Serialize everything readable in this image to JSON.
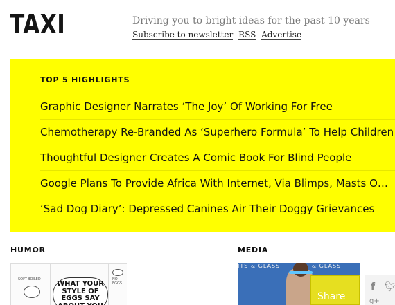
{
  "header": {
    "logo": "TAXI",
    "tagline": "Driving you to bright ideas for the past 10 years",
    "links": [
      "Subscribe to newsletter",
      "RSS",
      "Advertise"
    ]
  },
  "highlights": {
    "title": "TOP 5 HIGHLIGHTS",
    "items": [
      "Graphic Designer Narrates ‘The Joy’ Of Working For Free",
      "Chemotherapy Re-Branded As ‘Superhero Formula’ To Help Children",
      "Thoughtful Designer Creates A Comic Book For Blind People",
      "Google Plans To Provide Africa With Internet, Via Blimps, Masts O…",
      "‘Sad Dog Diary’: Depressed Canines Air Their Doggy Grievances"
    ],
    "background_color": "#ffff00"
  },
  "sections": {
    "humor": {
      "label": "HUMOR"
    },
    "media": {
      "label": "MEDIA"
    }
  },
  "humor_thumb": {
    "panel1": "SOFT-BOILED",
    "bubble": "WHAT YOUR STYLE OF EGGS SAY ABOUT YOU",
    "panel3": "NO EGGS"
  },
  "media_thumb": {
    "sign1": "ITS & GLASS",
    "sign2": "ITS & GLASS"
  },
  "share": {
    "label": "Share",
    "icons": [
      "facebook-icon",
      "twitter-icon",
      "google-plus-icon"
    ]
  }
}
